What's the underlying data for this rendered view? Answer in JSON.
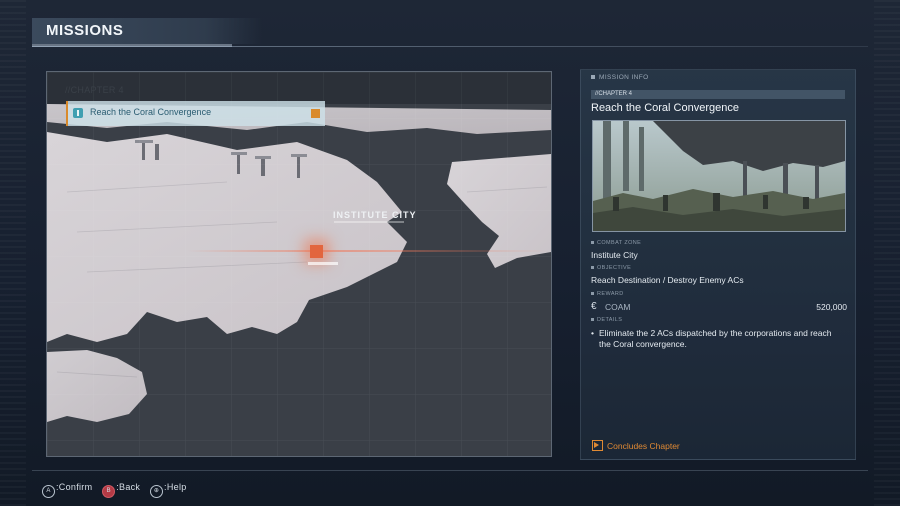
{
  "header": {
    "title": "MISSIONS"
  },
  "map": {
    "chapter": "//CHAPTER 4",
    "selected_mission": "Reach the Coral Convergence",
    "city_label": "INSTITUTE CITY"
  },
  "info": {
    "section_title": "MISSION INFO",
    "chapter": "//CHAPTER 4",
    "title": "Reach the Coral Convergence",
    "combat_zone_label": "COMBAT ZONE",
    "combat_zone": "Institute City",
    "objective_label": "OBJECTIVE",
    "objective": "Reach Destination / Destroy Enemy ACs",
    "reward_label": "REWARD",
    "currency_icon": "€",
    "currency": "COAM",
    "reward": "520,000",
    "detail_label": "DETAILS",
    "detail": "Eliminate the 2 ACs dispatched by the corporations and reach the Coral convergence.",
    "concludes": "Concludes Chapter"
  },
  "footer": {
    "confirm_glyph": "A",
    "confirm": ":Confirm",
    "back_glyph": "B",
    "back": ":Back",
    "help_glyph": "⊕",
    "help": ":Help"
  },
  "colors": {
    "accent": "#e08a34",
    "mission_flag": "#3f9fb1",
    "marker": "#e2653e"
  }
}
